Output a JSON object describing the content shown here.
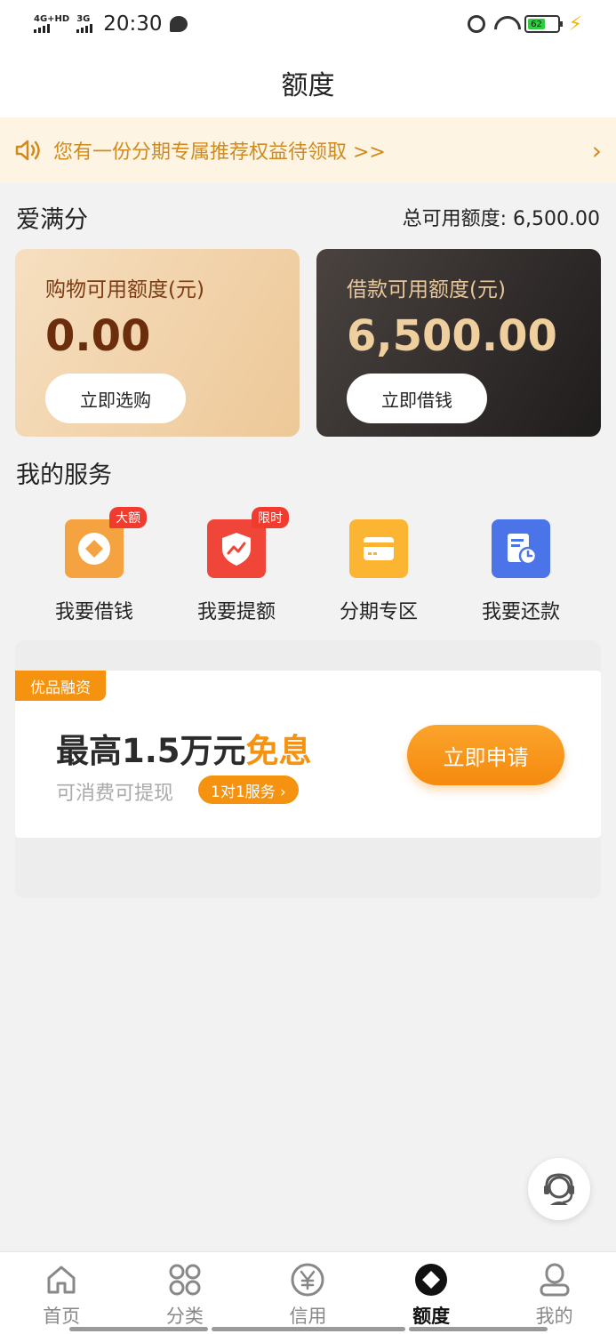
{
  "status_bar": {
    "net1": "4G+HD",
    "net2": "3G",
    "time": "20:30",
    "battery": "62"
  },
  "header": {
    "title": "额度"
  },
  "notice": {
    "text": "您有一份分期专属推荐权益待领取 >>"
  },
  "score": {
    "title": "爱满分",
    "total_credit": "总可用额度: 6,500.00"
  },
  "cards": {
    "shop": {
      "label": "购物可用额度(元)",
      "amount": "0.00",
      "button": "立即选购"
    },
    "loan": {
      "label": "借款可用额度(元)",
      "amount": "6,500.00",
      "button": "立即借钱"
    }
  },
  "services": {
    "title": "我的服务",
    "items": [
      {
        "label": "我要借钱",
        "badge": "大额",
        "icon": "coin-icon",
        "color": "#f4a340"
      },
      {
        "label": "我要提额",
        "badge": "限时",
        "icon": "shield-chart-icon",
        "color": "#f0463a"
      },
      {
        "label": "分期专区",
        "badge": "",
        "icon": "card-icon",
        "color": "#fbb533"
      },
      {
        "label": "我要还款",
        "badge": "",
        "icon": "bill-clock-icon",
        "color": "#4a74e8"
      }
    ]
  },
  "promo": {
    "tag": "优品融资",
    "headline_prefix": "最高1.5万元",
    "headline_highlight": "免息",
    "sub": "可消费可提现",
    "chip": "1对1服务 ›",
    "button": "立即申请"
  },
  "nav": {
    "items": [
      {
        "label": "首页",
        "icon": "home-icon",
        "active": false
      },
      {
        "label": "分类",
        "icon": "grid-icon",
        "active": false
      },
      {
        "label": "信用",
        "icon": "yen-icon",
        "active": false
      },
      {
        "label": "额度",
        "icon": "diamond-icon",
        "active": true
      },
      {
        "label": "我的",
        "icon": "profile-icon",
        "active": false
      }
    ]
  },
  "colors": {
    "accent": "#f59210",
    "notice_text": "#d08a1e",
    "notice_bg": "#fdf4e3"
  }
}
